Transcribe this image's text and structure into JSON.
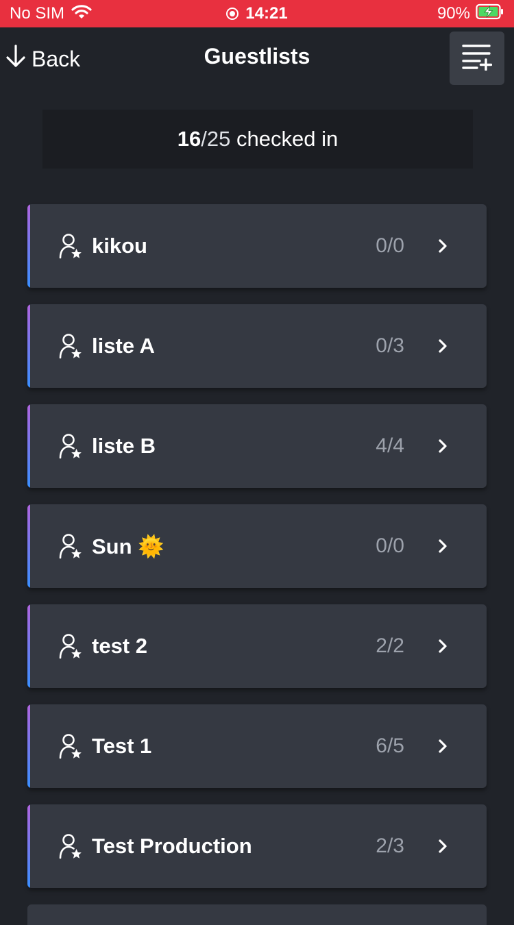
{
  "status_bar": {
    "carrier": "No SIM",
    "time": "14:21",
    "battery": "90%",
    "icons": [
      "wifi-icon",
      "recording-icon",
      "battery-charging-icon"
    ]
  },
  "nav": {
    "back_label": "Back",
    "title": "Guestlists",
    "back_icon": "arrow-down-icon",
    "add_icon": "add-list-icon"
  },
  "summary": {
    "checked": "16",
    "separator": "/",
    "total": "25",
    "label": " checked in"
  },
  "guestlists": [
    {
      "name": "kikou",
      "count": "0/0"
    },
    {
      "name": "liste A",
      "count": "0/3"
    },
    {
      "name": "liste B",
      "count": "4/4"
    },
    {
      "name": "Sun 🌞",
      "count": "0/0"
    },
    {
      "name": "test 2",
      "count": "2/2"
    },
    {
      "name": "Test 1",
      "count": "6/5"
    },
    {
      "name": "Test Production",
      "count": "2/3"
    }
  ],
  "colors": {
    "status_bar": "#e8303f",
    "background": "#202329",
    "card": "#353942",
    "accent_top": "#b065e0",
    "accent_bottom": "#3a8fff",
    "count_text": "#9da2ac"
  }
}
